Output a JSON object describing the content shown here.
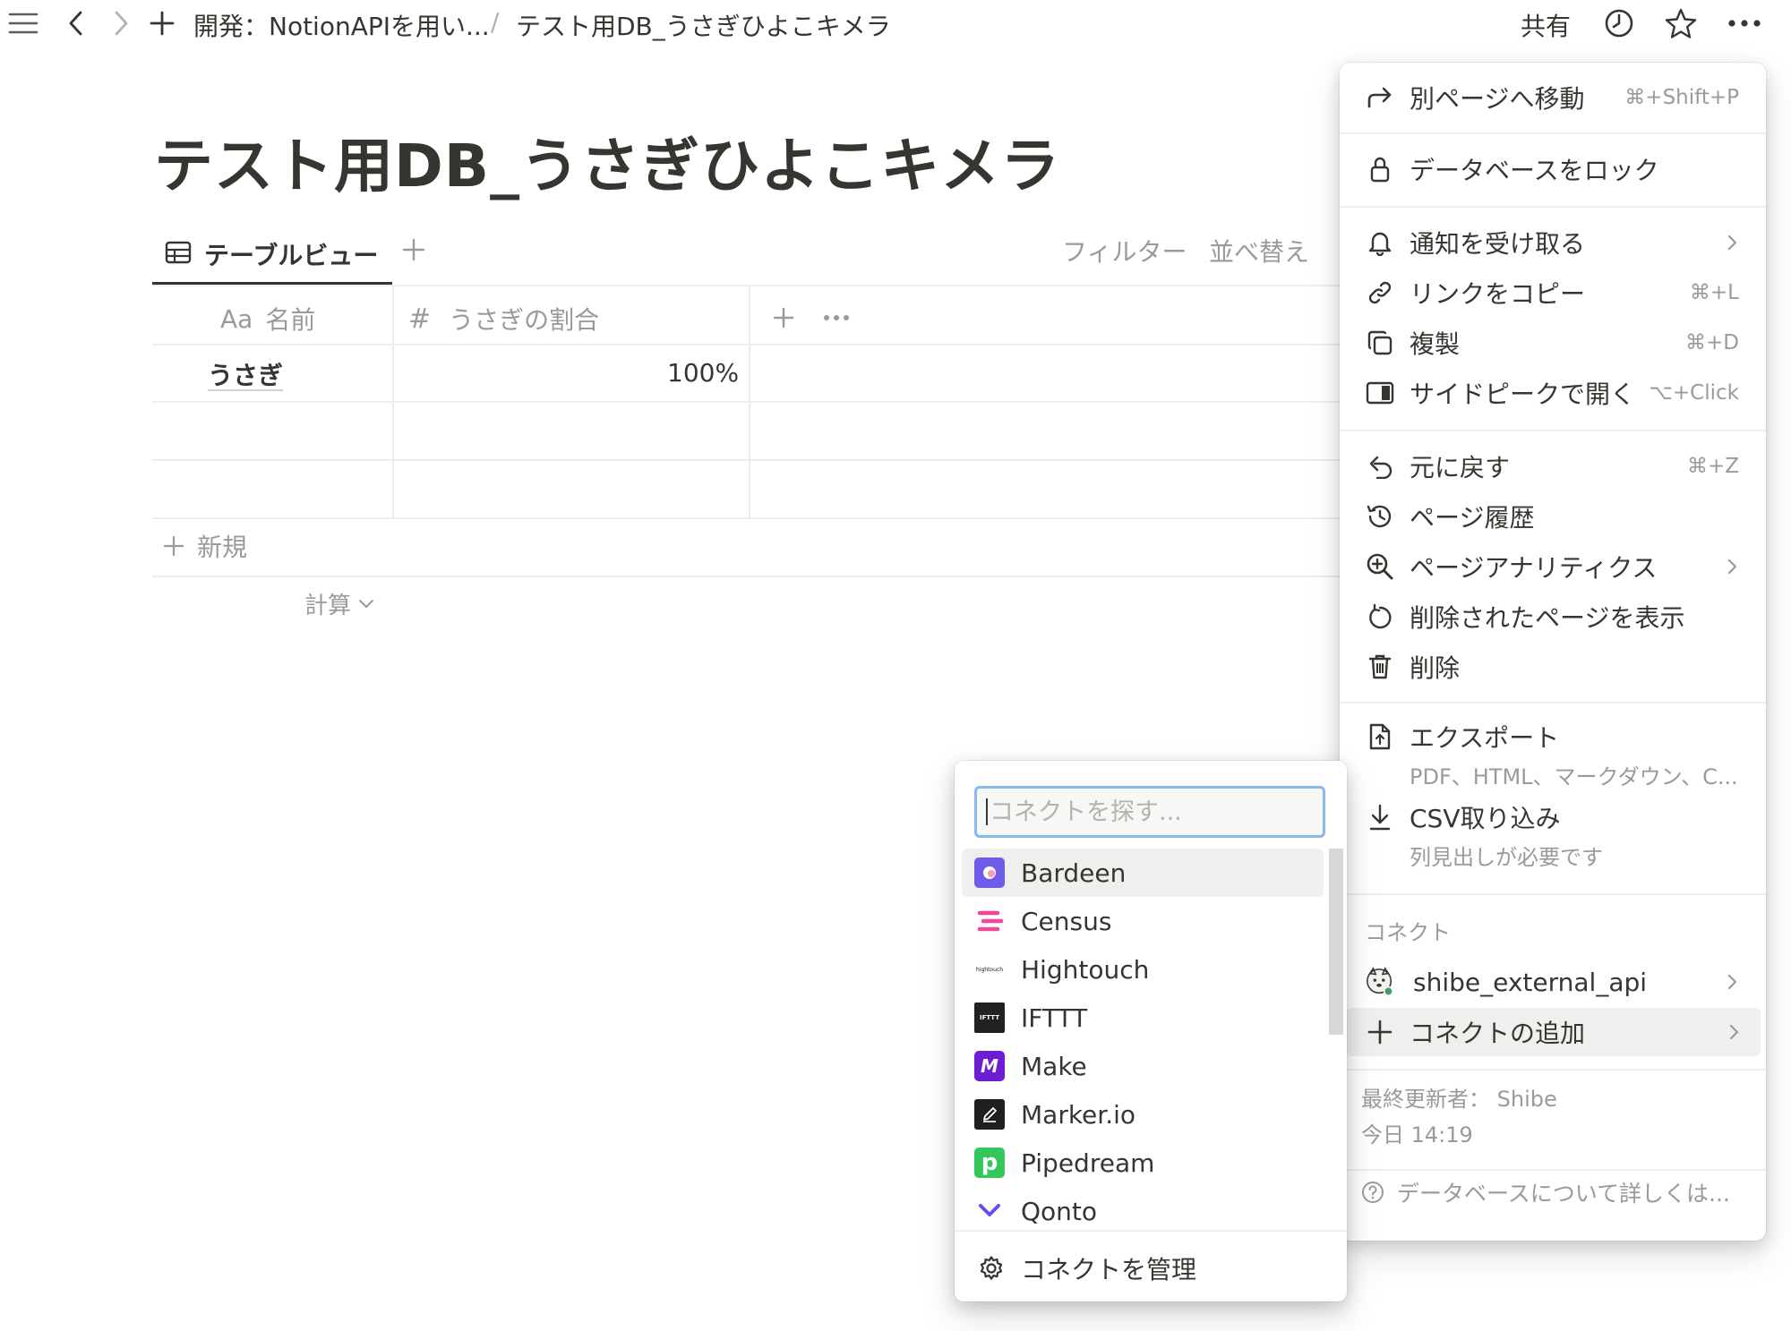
{
  "topbar": {
    "breadcrumb_parent": "開発：NotionAPIを用い...",
    "breadcrumb_sep": "/",
    "breadcrumb_current": "テスト用DB_うさぎひよこキメラ",
    "share_label": "共有"
  },
  "page": {
    "title": "テスト用DB_うさぎひよこキメラ"
  },
  "view": {
    "tab_label": "テーブルビュー",
    "filter_label": "フィルター",
    "sort_label": "並べ替え"
  },
  "table": {
    "columns": [
      {
        "icon": "Aa",
        "label": "名前"
      },
      {
        "icon": "#",
        "label": "うさぎの割合"
      }
    ],
    "rows": [
      {
        "name": "うさぎ",
        "ratio": "100%"
      },
      {
        "name": "",
        "ratio": ""
      },
      {
        "name": "",
        "ratio": ""
      }
    ],
    "new_label": "新規",
    "calc_label": "計算"
  },
  "menu": {
    "move": {
      "label": "別ページへ移動",
      "shortcut": "⌘+Shift+P"
    },
    "lock": {
      "label": "データベースをロック"
    },
    "notify": {
      "label": "通知を受け取る"
    },
    "copy_link": {
      "label": "リンクをコピー",
      "shortcut": "⌘+L"
    },
    "duplicate": {
      "label": "複製",
      "shortcut": "⌘+D"
    },
    "side_peek": {
      "label": "サイドピークで開く",
      "shortcut": "⌥+Click"
    },
    "undo": {
      "label": "元に戻す",
      "shortcut": "⌘+Z"
    },
    "history": {
      "label": "ページ履歴"
    },
    "analytics": {
      "label": "ページアナリティクス"
    },
    "deleted": {
      "label": "削除されたページを表示"
    },
    "delete": {
      "label": "削除"
    },
    "export": {
      "label": "エクスポート",
      "sub": "PDF、HTML、マークダウン、C..."
    },
    "csv": {
      "label": "CSV取り込み",
      "sub": "列見出しが必要です"
    },
    "connect_section": "コネクト",
    "connection_name": "shibe_external_api",
    "add_connection": "コネクトの追加",
    "last_edited_by": "最終更新者： Shibe",
    "last_edited_time": "今日 14:19",
    "help": "データベースについて詳しくは..."
  },
  "connect_popup": {
    "search_placeholder": "コネクトを探す...",
    "items": [
      {
        "name": "Bardeen",
        "color": "#6c5ce7"
      },
      {
        "name": "Census",
        "color": "#f2479b"
      },
      {
        "name": "Hightouch",
        "logo_text": "hightouch",
        "color": "#111111"
      },
      {
        "name": "IFTTT",
        "logo_text": "IFTTT",
        "color": "#222222"
      },
      {
        "name": "Make",
        "logo_text": "M",
        "color": "#6d1ed4"
      },
      {
        "name": "Marker.io",
        "color": "#1f1f1f"
      },
      {
        "name": "Pipedream",
        "logo_text": "p",
        "color": "#34c759"
      },
      {
        "name": "Qonto",
        "color": "#6a4cf5"
      }
    ],
    "manage_label": "コネクトを管理"
  }
}
